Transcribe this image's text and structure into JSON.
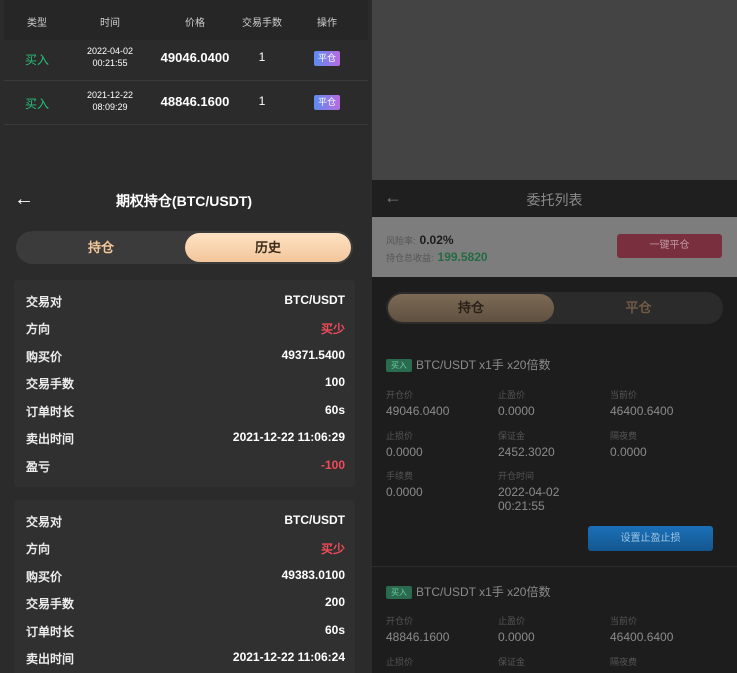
{
  "left": {
    "table": {
      "headers": [
        "类型",
        "时间",
        "价格",
        "交易手数",
        "操作"
      ],
      "rows": [
        {
          "type": "买入",
          "date": "2022-04-02",
          "time": "00:21:55",
          "price": "49046.0400",
          "hands": "1",
          "action": "平仓"
        },
        {
          "type": "买入",
          "date": "2021-12-22",
          "time": "08:09:29",
          "price": "48846.1600",
          "hands": "1",
          "action": "平仓"
        }
      ]
    },
    "nav": {
      "back": "←",
      "title": "期权持仓(BTC/USDT)"
    },
    "tabs": {
      "holding": "持仓",
      "history": "历史"
    },
    "cards": [
      {
        "pair_label": "交易对",
        "pair": "BTC/USDT",
        "dir_label": "方向",
        "dir": "买少",
        "buy_label": "购买价",
        "buy": "49371.5400",
        "hands_label": "交易手数",
        "hands": "100",
        "dur_label": "订单时长",
        "dur": "60s",
        "sell_label": "卖出时间",
        "sell": "2021-12-22 11:06:29",
        "pnl_label": "盈亏",
        "pnl": "-100"
      },
      {
        "pair_label": "交易对",
        "pair": "BTC/USDT",
        "dir_label": "方向",
        "dir": "买少",
        "buy_label": "购买价",
        "buy": "49383.0100",
        "hands_label": "交易手数",
        "hands": "200",
        "dur_label": "订单时长",
        "dur": "60s",
        "sell_label": "卖出时间",
        "sell": "2021-12-22 11:06:24"
      }
    ]
  },
  "right": {
    "nav": {
      "back": "←",
      "title": "委托列表"
    },
    "risk": {
      "rate_label": "风险率:",
      "rate": "0.02%",
      "income_label": "持仓总收益:",
      "income": "199.5820",
      "close_all": "一键平仓"
    },
    "tabs": {
      "holding": "持仓",
      "closed": "平仓"
    },
    "positions": [
      {
        "tag": "买入",
        "title": "BTC/USDT x1手 x20倍数",
        "open_label": "开仓价",
        "open": "49046.0400",
        "sl_label": "止盈价",
        "sl": "0.0000",
        "cur_label": "当前价",
        "cur": "46400.6400",
        "tp_label": "止损价",
        "tp": "0.0000",
        "margin_label": "保证金",
        "margin": "2452.3020",
        "overnight_label": "隔夜费",
        "overnight": "0.0000",
        "fee_label": "手续费",
        "fee": "0.0000",
        "otime_label": "开仓时间",
        "odate": "2022-04-02",
        "otime": "00:21:55",
        "set_btn": "设置止盈止损"
      },
      {
        "tag": "买入",
        "title": "BTC/USDT x1手 x20倍数",
        "open_label": "开仓价",
        "open": "48846.1600",
        "sl_label": "止盈价",
        "sl": "0.0000",
        "cur_label": "当前价",
        "cur": "46400.6400",
        "tp_label": "止损价",
        "margin_label": "保证金",
        "overnight_label": "隔夜费"
      }
    ]
  },
  "colors": {
    "buy_green": "#27c27a",
    "sell_red": "#ef4b5b",
    "accent_gold": "#f2c69c"
  }
}
